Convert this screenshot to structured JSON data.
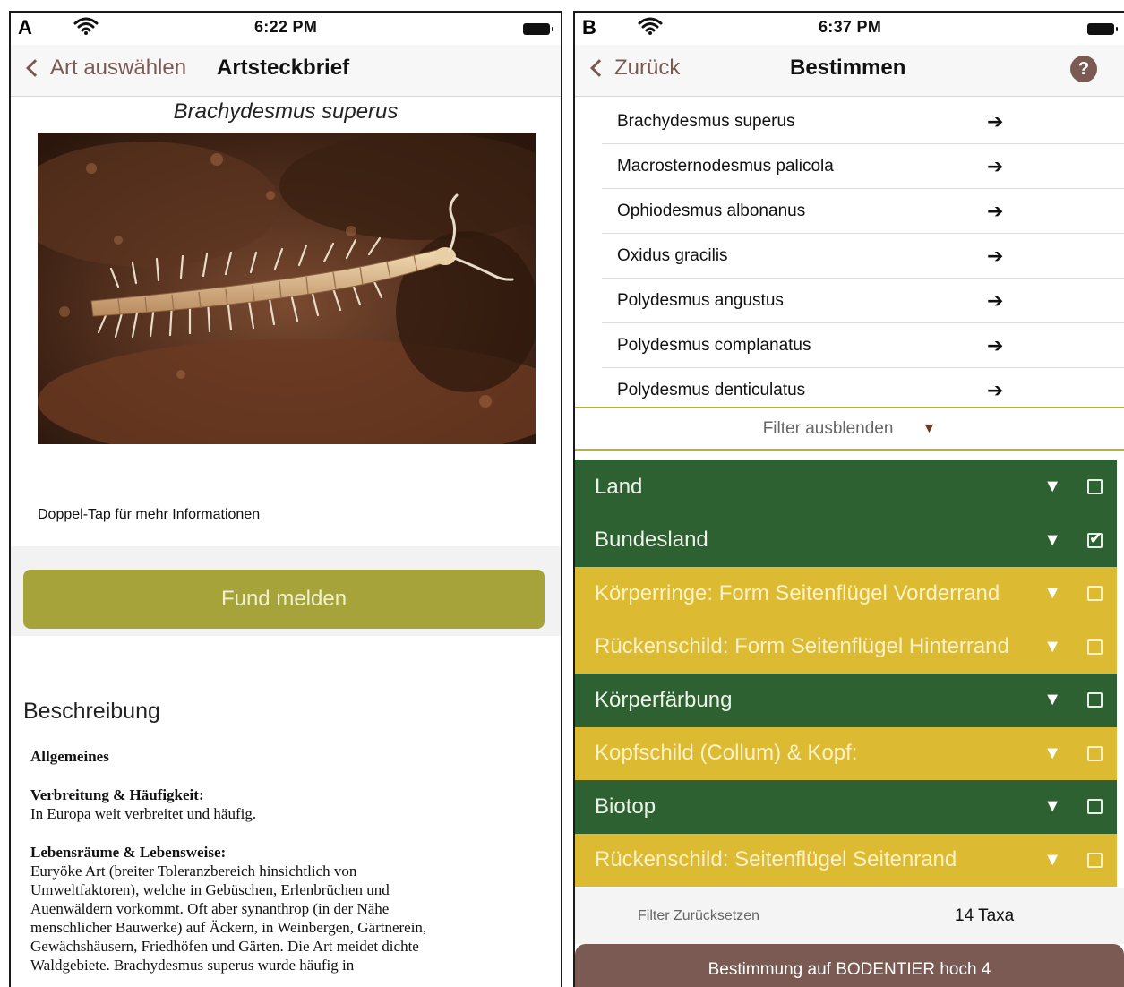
{
  "panel_a": {
    "letter": "A",
    "status": {
      "time": "6:22 PM"
    },
    "nav": {
      "back_label": "Art auswählen",
      "title": "Artsteckbrief"
    },
    "species_name": "Brachydesmus superus",
    "hint": "Doppel-Tap für mehr Informationen",
    "report_button": "Fund melden",
    "description_heading": "Beschreibung",
    "description": {
      "general_heading": "Allgemeines",
      "distribution_heading": "Verbreitung & Häufigkeit:",
      "distribution_text": "In Europa weit verbreitet und häufig.",
      "habitat_heading": "Lebensräume & Lebensweise:",
      "habitat_lines": [
        "Euryöke Art (breiter Toleranzbereich hinsichtlich von",
        "Umweltfaktoren), welche in Gebüschen, Erlenbrüchen und",
        "Auenwäldern vorkommt. Oft aber synanthrop (in der Nähe",
        "menschlicher Bauwerke) auf Äckern, in Weinbergen, Gärtnerein,",
        "Gewächshäusern, Friedhöfen und Gärten. Die Art meidet dichte",
        "Waldgebiete. Brachydesmus superus wurde häufig in"
      ]
    }
  },
  "panel_b": {
    "letter": "B",
    "status": {
      "time": "6:37 PM"
    },
    "nav": {
      "back_label": "Zurück",
      "title": "Bestimmen",
      "help_glyph": "?"
    },
    "taxa": [
      "Brachydesmus superus",
      "Macrosternodesmus palicola",
      "Ophiodesmus albonanus",
      "Oxidus gracilis",
      "Polydesmus angustus",
      "Polydesmus complanatus",
      "Polydesmus denticulatus"
    ],
    "arrow_glyph": "➔",
    "filter_toggle": "Filter ausblenden",
    "triangle_glyph": "▼",
    "filters": [
      {
        "label": "Land",
        "color": "green",
        "checked": false
      },
      {
        "label": "Bundesland",
        "color": "green",
        "checked": true
      },
      {
        "label": "Körperringe: Form Seitenflügel Vorderrand",
        "color": "yellow",
        "checked": false
      },
      {
        "label": "Rückenschild: Form Seitenflügel Hinterrand",
        "color": "yellow",
        "checked": false
      },
      {
        "label": "Körperfärbung",
        "color": "green",
        "checked": false
      },
      {
        "label": "Kopfschild (Collum) & Kopf:",
        "color": "yellow",
        "checked": false
      },
      {
        "label": "Biotop",
        "color": "green",
        "checked": false
      },
      {
        "label": "Rückenschild: Seitenflügel Seitenrand",
        "color": "yellow",
        "checked": false
      }
    ],
    "reset_label": "Filter Zurücksetzen",
    "taxa_count": "14 Taxa",
    "submit_button": "Bestimmung auf BODENTIER hoch 4"
  },
  "colors": {
    "accent_brown": "#7a5a52",
    "olive_button": "#a6a33a",
    "filter_green": "#2e6131",
    "filter_yellow": "#dcbb33"
  }
}
